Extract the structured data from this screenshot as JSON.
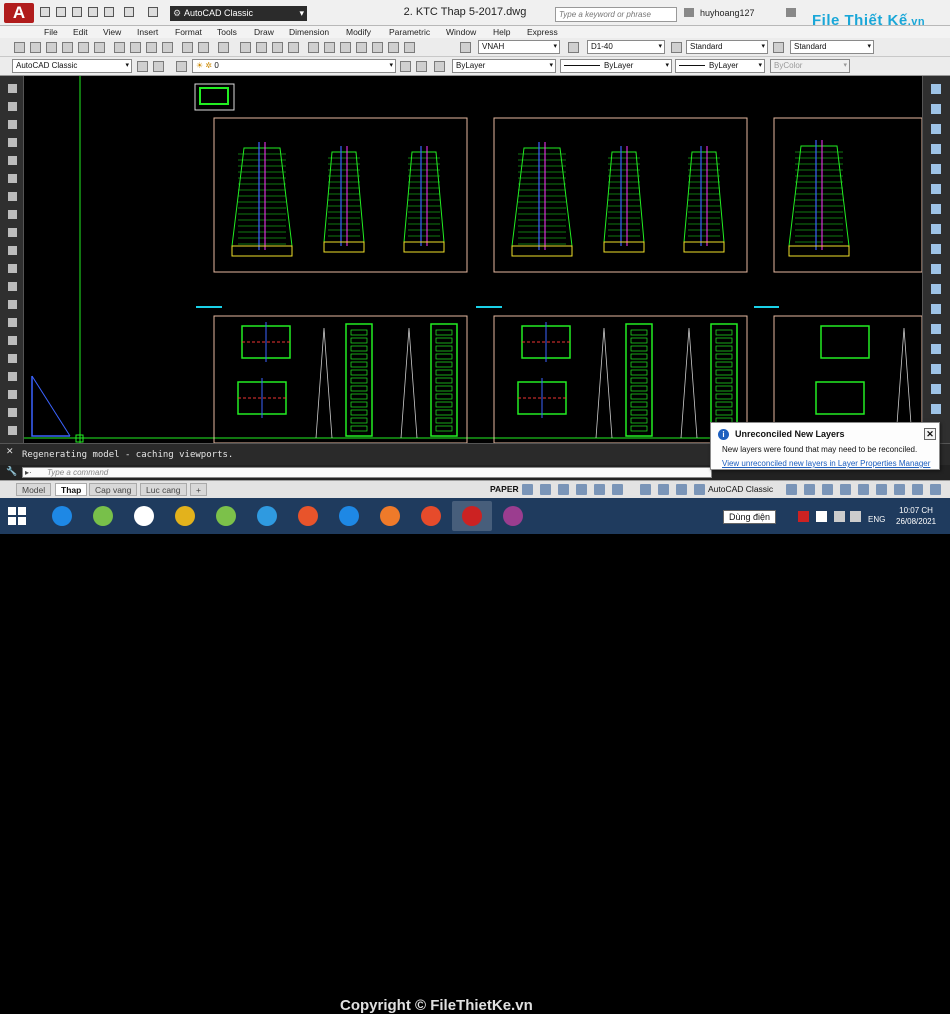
{
  "window": {
    "title": "2. KTC Thap 5-2017.dwg",
    "app_button": "A",
    "workspace": "AutoCAD Classic",
    "search_placeholder": "Type a keyword or phrase",
    "user": "huyhoang127",
    "watermark": "File Thiết Kế",
    "watermark_suffix": ".vn"
  },
  "menu": [
    "File",
    "Edit",
    "View",
    "Insert",
    "Format",
    "Tools",
    "Draw",
    "Dimension",
    "Modify",
    "Parametric",
    "Window",
    "Help",
    "Express"
  ],
  "toolbar1": {
    "text_style": "VNAH",
    "dim_style": "D1-40",
    "table_style": "Standard",
    "mleader_style": "Standard"
  },
  "toolbar2": {
    "workspace": "AutoCAD Classic",
    "layer": "0",
    "color": "ByLayer",
    "linetype": "ByLayer",
    "lineweight": "ByLayer",
    "plot_style": "ByColor"
  },
  "command": {
    "history": "Regenerating model - caching viewports.",
    "placeholder": "Type a command"
  },
  "layout_tabs": [
    {
      "label": "Model",
      "active": false
    },
    {
      "label": "Thap",
      "active": true
    },
    {
      "label": "Cap vang",
      "active": false
    },
    {
      "label": "Luc cang",
      "active": false
    },
    {
      "label": "+",
      "active": false
    }
  ],
  "status": {
    "space": "PAPER",
    "workspace": "AutoCAD Classic"
  },
  "balloon": {
    "title": "Unreconciled New Layers",
    "message": "New layers were found that may need to be reconciled.",
    "link": "View unreconciled new layers in Layer Properties Manager"
  },
  "taskbar": {
    "power": "Dùng điện",
    "language": "ENG",
    "time": "10:07 CH",
    "date": "26/08/2021",
    "apps": [
      {
        "name": "ie-icon",
        "color": "#1e88e5"
      },
      {
        "name": "utorrent-icon",
        "color": "#78c04a"
      },
      {
        "name": "edit-icon",
        "color": "#ffffff"
      },
      {
        "name": "chrome-icon",
        "color": "#e3b21c"
      },
      {
        "name": "coccoc-icon",
        "color": "#7cc14a"
      },
      {
        "name": "ultraviewer-icon",
        "color": "#2f9ae0"
      },
      {
        "name": "foxit-icon",
        "color": "#e8542b"
      },
      {
        "name": "zalo-icon",
        "color": "#1e88e5"
      },
      {
        "name": "ez-icon",
        "color": "#ef7a2a"
      },
      {
        "name": "weibo-icon",
        "color": "#e64b2b"
      },
      {
        "name": "autocad-icon",
        "color": "#c22"
      },
      {
        "name": "winrar-icon",
        "color": "#9b3d8f"
      }
    ]
  },
  "copyright": "Copyright © FileThietKe.vn",
  "colors": {
    "drawing_green": "#22ee22",
    "frame": "#e6b9a0",
    "cyan": "#1ad1e8",
    "magenta": "#ff33ff",
    "blue": "#3b63ff",
    "yellow": "#f0e02a"
  }
}
